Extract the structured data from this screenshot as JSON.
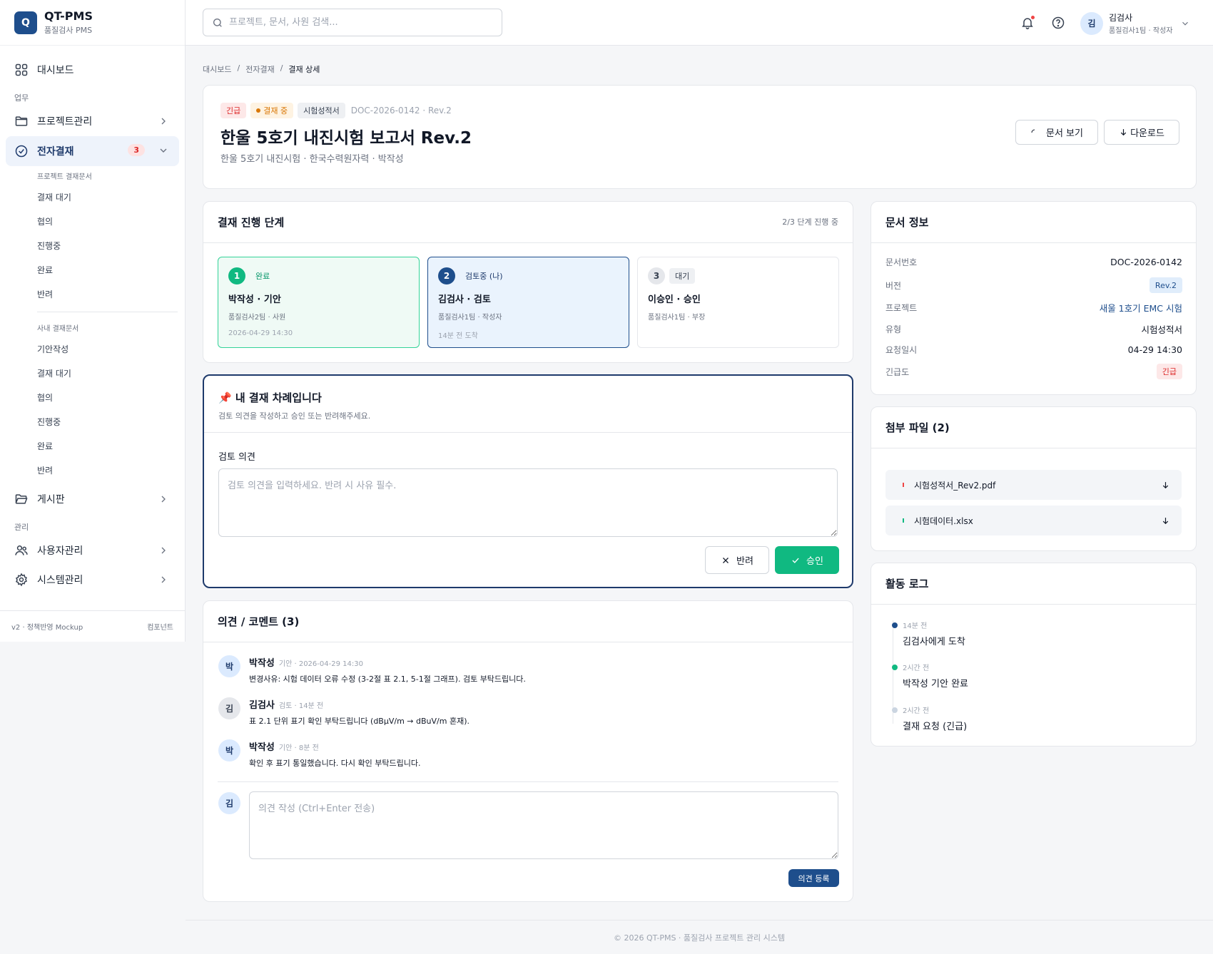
{
  "brand": {
    "logo": "Q",
    "name": "QT-PMS",
    "sub": "품질검사 PMS"
  },
  "search": {
    "placeholder": "프로젝트, 문서, 사원 검색..."
  },
  "user": {
    "avatar": "김",
    "name": "김검사",
    "role": "품질검사1팀 · 작성자"
  },
  "nav": {
    "dashboard": "대시보드",
    "sec_work": "업무",
    "projects": "프로젝트관리",
    "approval": "전자결재",
    "approval_badge": "3",
    "sub_project_head": "프로젝트 결재문서",
    "sub_project": [
      "결재 대기",
      "협의",
      "진행중",
      "완료",
      "반려"
    ],
    "sub_internal_head": "사내 결재문서",
    "sub_internal": [
      "기안작성",
      "결재 대기",
      "협의",
      "진행중",
      "완료",
      "반려"
    ],
    "board": "게시판",
    "sec_admin": "관리",
    "users": "사용자관리",
    "system": "시스템관리"
  },
  "sidebar_footer": {
    "left": "v2 · 정책반영 Mockup",
    "right": "컴포넌트"
  },
  "breadcrumb": [
    "대시보드",
    "전자결재",
    "결재 상세"
  ],
  "doc": {
    "tag_urgent": "긴급",
    "tag_status": "결재 중",
    "tag_type": "시험성적서",
    "doc_id": "DOC-2026-0142 · Rev.2",
    "title": "한울 5호기 내진시험 보고서 Rev.2",
    "subtitle": "한울 5호기 내진시험 · 한국수력원자력 · 박작성",
    "view_btn": "문서 보기",
    "download_btn": "다운로드"
  },
  "steps": {
    "title": "결재 진행 단계",
    "progress": "2/3 단계 진행 중",
    "items": [
      {
        "num": "1",
        "status": "완료",
        "name": "박작성 · 기안",
        "team": "품질검사2팀 · 사원",
        "time": "2026-04-29 14:30"
      },
      {
        "num": "2",
        "status": "검토중 (나)",
        "name": "김검사 · 검토",
        "team": "품질검사1팀 · 작성자",
        "time": "14분 전 도착"
      },
      {
        "num": "3",
        "status": "대기",
        "name": "이승인 · 승인",
        "team": "품질검사1팀 · 부장",
        "time": ""
      }
    ]
  },
  "myturn": {
    "title": "📌 내 결재 차례입니다",
    "desc": "검토 의견을 작성하고 승인 또는 반려해주세요.",
    "label": "검토 의견",
    "placeholder": "검토 의견을 입력하세요. 반려 시 사유 필수.",
    "reject": "반려",
    "approve": "승인"
  },
  "comments": {
    "title": "의견 / 코멘트 (3)",
    "items": [
      {
        "avatar": "박",
        "name": "박작성",
        "meta": "기안 · 2026-04-29 14:30",
        "text": "변경사유: 시험 데이터 오류 수정 (3-2절 표 2.1, 5-1절 그래프). 검토 부탁드립니다."
      },
      {
        "avatar": "김",
        "name": "김검사",
        "meta": "검토 · 14분 전",
        "text": "표 2.1 단위 표기 확인 부탁드립니다 (dBμV/m → dBuV/m 혼재)."
      },
      {
        "avatar": "박",
        "name": "박작성",
        "meta": "기안 · 8분 전",
        "text": "확인 후 표기 통일했습니다. 다시 확인 부탁드립니다."
      }
    ],
    "my_avatar": "김",
    "placeholder": "의견 작성 (Ctrl+Enter 전송)",
    "submit": "의견 등록"
  },
  "docinfo": {
    "title": "문서 정보",
    "rows": [
      {
        "k": "문서번호",
        "v": "DOC-2026-0142"
      },
      {
        "k": "버전",
        "v": "Rev.2"
      },
      {
        "k": "프로젝트",
        "v": "새울 1호기 EMC 시험"
      },
      {
        "k": "유형",
        "v": "시험성적서"
      },
      {
        "k": "요청일시",
        "v": "04-29 14:30"
      },
      {
        "k": "긴급도",
        "v": "긴급"
      }
    ]
  },
  "files": {
    "title": "첨부 파일 (2)",
    "items": [
      {
        "name": "시험성적서_Rev2.pdf",
        "color": "#ef4444"
      },
      {
        "name": "시험데이터.xlsx",
        "color": "#10b981"
      }
    ]
  },
  "activity": {
    "title": "활동 로그",
    "items": [
      {
        "time": "14분 전",
        "text": "김검사에게 도착",
        "color": "#1e4e8c"
      },
      {
        "time": "2시간 전",
        "text": "박작성 기안 완료",
        "color": "#10b981"
      },
      {
        "time": "2시간 전",
        "text": "결재 요청 (긴급)",
        "color": "#cbd5e1"
      }
    ]
  },
  "footer": "© 2026 QT-PMS · 품질검사 프로젝트 관리 시스템",
  "colors": {
    "accent": "#1e4e8c",
    "success": "#10b981",
    "danger": "#dc2626",
    "warning": "#d97706"
  }
}
